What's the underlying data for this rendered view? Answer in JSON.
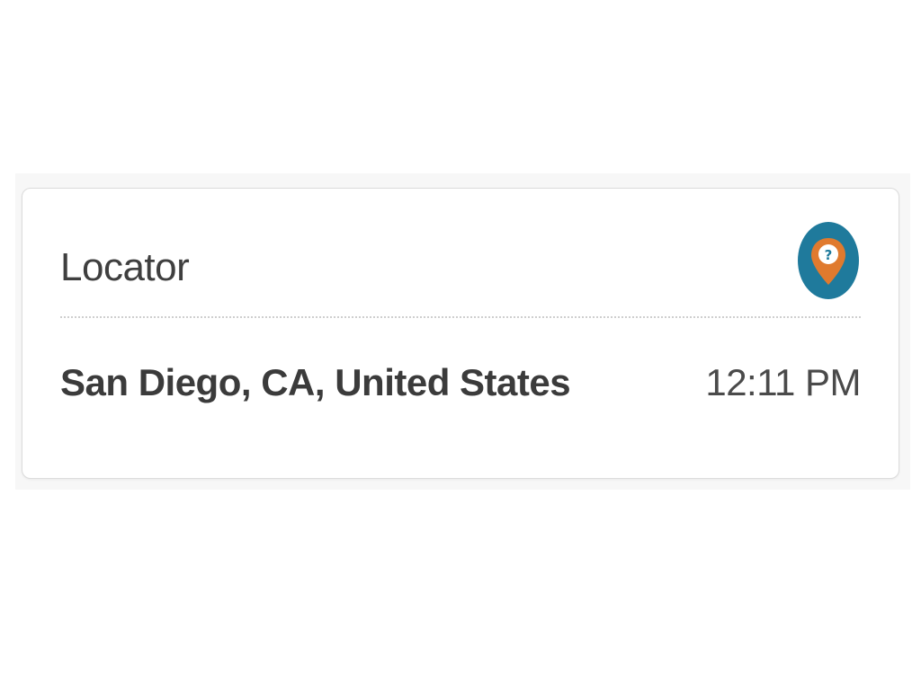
{
  "widget": {
    "title": "Locator",
    "icon": "map-pin-icon",
    "location": "San Diego, CA, United States",
    "time": "12:11 PM"
  },
  "colors": {
    "icon_background": "#1f7a9c",
    "pin": "#e07a2e",
    "pin_glyph": "#1f7a9c",
    "title_text": "#3f3f3f",
    "location_text": "#3b3b3b",
    "time_text": "#4a4a4a"
  }
}
